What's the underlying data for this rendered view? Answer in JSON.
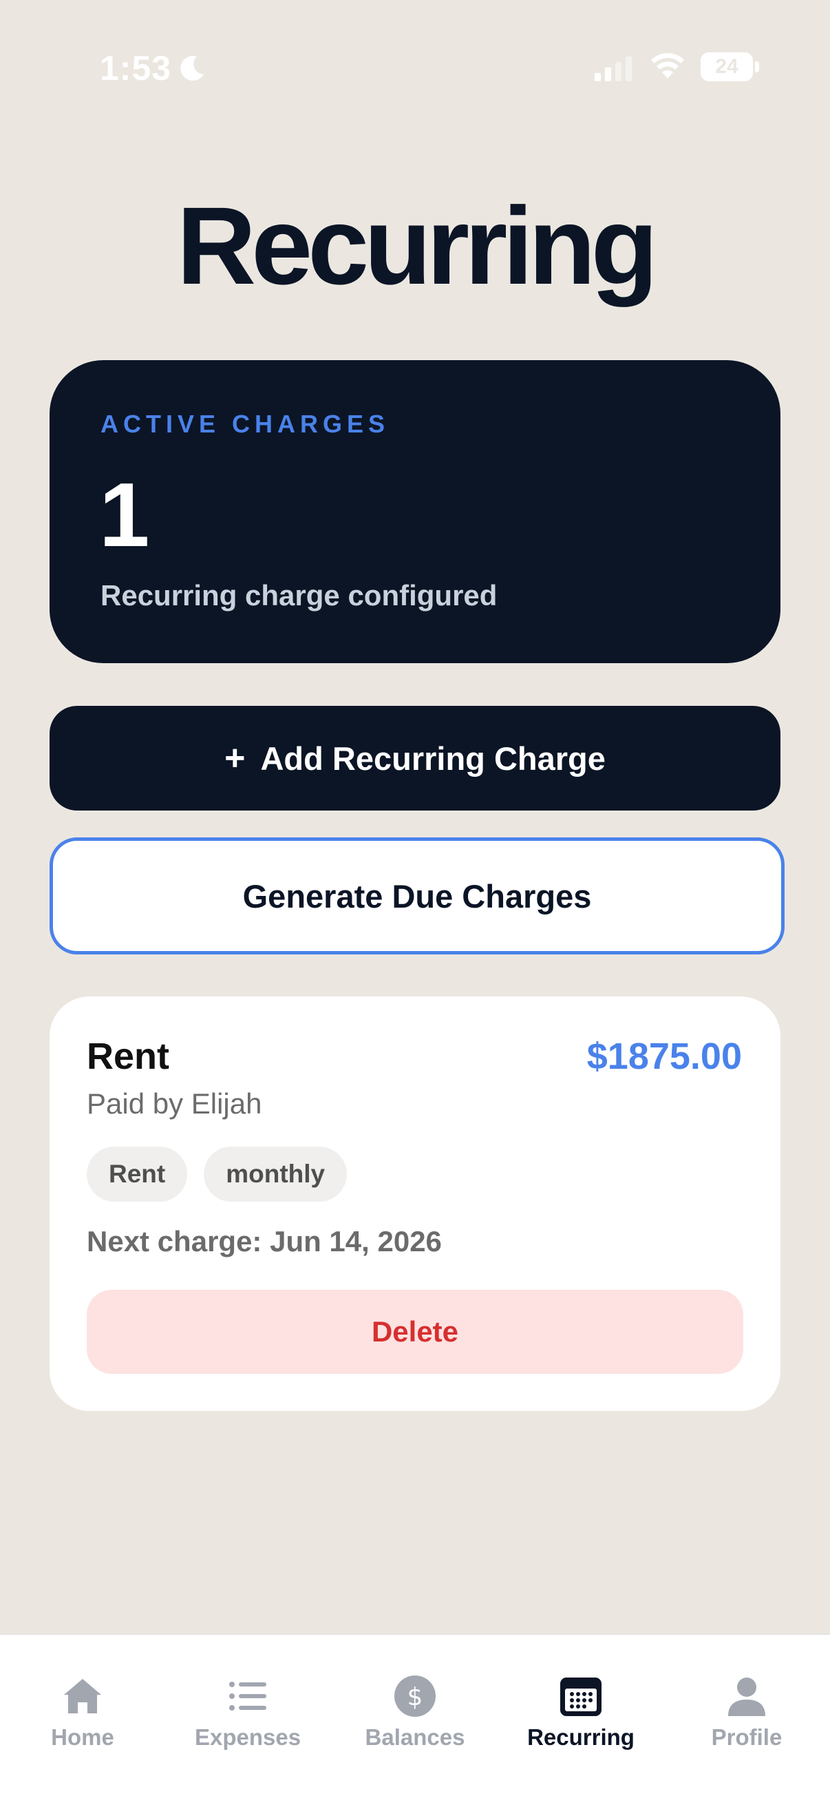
{
  "status_bar": {
    "time": "1:53",
    "battery": "24"
  },
  "page": {
    "title": "Recurring"
  },
  "summary": {
    "kicker": "ACTIVE CHARGES",
    "count": "1",
    "description": "Recurring charge configured"
  },
  "actions": {
    "add_plus": "+",
    "add_label": "Add Recurring Charge",
    "generate_label": "Generate Due Charges"
  },
  "charges": [
    {
      "name": "Rent",
      "amount": "$1875.00",
      "paid_by": "Paid by Elijah",
      "tags": [
        "Rent",
        "monthly"
      ],
      "next_charge": "Next charge: Jun 14, 2026",
      "delete_label": "Delete"
    }
  ],
  "tab_bar": {
    "tabs": [
      {
        "label": "Home",
        "icon": "home-icon",
        "active": false
      },
      {
        "label": "Expenses",
        "icon": "list-icon",
        "active": false
      },
      {
        "label": "Balances",
        "icon": "dollar-icon",
        "active": false
      },
      {
        "label": "Recurring",
        "icon": "calendar-icon",
        "active": true
      },
      {
        "label": "Profile",
        "icon": "person-icon",
        "active": false
      }
    ]
  },
  "colors": {
    "background": "#ebe7e0",
    "navy": "#0b1526",
    "accent_blue": "#4a82ea",
    "danger": "#d62f2f",
    "danger_bg": "#fde2e1",
    "inactive_tab": "#a1a6af"
  }
}
